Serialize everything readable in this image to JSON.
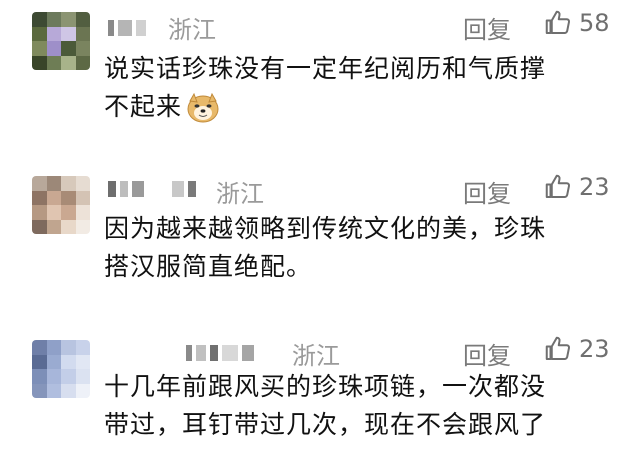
{
  "comments": [
    {
      "location": "浙江",
      "reply_label": "回复",
      "likes": "58",
      "lines": [
        "说实话珍珠没有一定年纪阅历和气质撑",
        "不起来"
      ],
      "emoji": "doge-emoji"
    },
    {
      "location": "浙江",
      "reply_label": "回复",
      "likes": "23",
      "lines": [
        "因为越来越领略到传统文化的美，珍珠",
        "搭汉服简直绝配。"
      ]
    },
    {
      "location": "浙江",
      "reply_label": "回复",
      "likes": "23",
      "lines": [
        "十几年前跟风买的珍珠项链，一次都没",
        "带过，耳钉带过几次，现在不会跟风了"
      ]
    }
  ],
  "colors": {
    "text": "#111111",
    "meta": "#9a9a9a",
    "background": "#ffffff"
  },
  "icons": {
    "like": "thumbs-up-icon"
  }
}
